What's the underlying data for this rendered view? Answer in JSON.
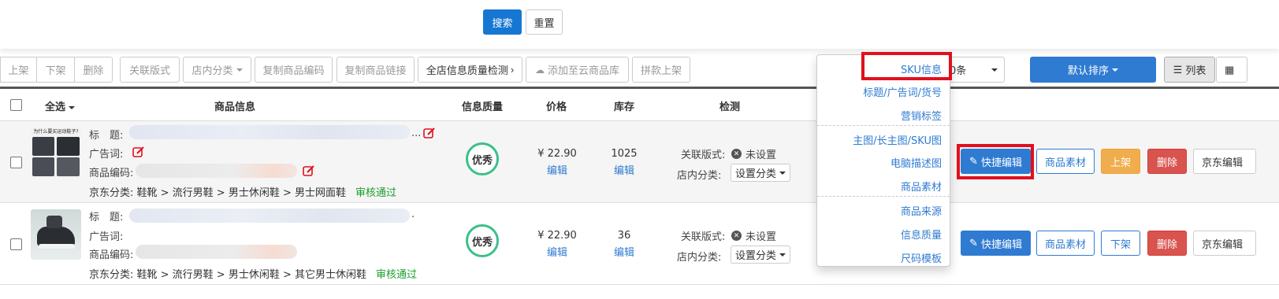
{
  "filters": {
    "search_label": "搜索",
    "reset_label": "重置"
  },
  "toolbar": {
    "buttons": [
      "上架",
      "下架",
      "删除",
      "关联版式",
      "店内分类",
      "复制商品编码",
      "复制商品链接",
      "全店信息质量检测",
      "添加至云商品库",
      "拼款上架"
    ],
    "page_size_value": "0条",
    "sort_label": "默认排序",
    "view_list_label": "列表"
  },
  "table": {
    "headers": {
      "select_all": "全选",
      "product_info": "商品信息",
      "quality": "信息质量",
      "price": "价格",
      "stock": "库存",
      "check": "检测"
    },
    "field_labels": {
      "title": "标　题:",
      "ad": "广告词:",
      "code": "商品编码:",
      "linked_layout": "关联版式:",
      "store_category": "店内分类:"
    },
    "rows": [
      {
        "title_suffix": "...",
        "jd_category": "京东分类: 鞋靴 > 流行男鞋 > 男士休闲鞋 > 男士网面鞋",
        "review_status": "审核通过",
        "quality": "优秀",
        "price": "¥ 22.90",
        "price_edit": "编辑",
        "stock": "1025",
        "stock_edit": "编辑",
        "linked_layout_value": "未设置",
        "store_category_value": "设置分类",
        "actions": [
          "快捷编辑",
          "商品素材",
          "上架",
          "删除",
          "京东编辑"
        ]
      },
      {
        "title_suffix": ".",
        "jd_category": "京东分类: 鞋靴 > 流行男鞋 > 男士休闲鞋 > 其它男士休闲鞋",
        "review_status": "审核通过",
        "quality": "优秀",
        "price": "¥ 22.90",
        "price_edit": "编辑",
        "stock": "36",
        "stock_edit": "编辑",
        "linked_layout_value": "未设置",
        "store_category_value": "设置分类",
        "actions": [
          "快捷编辑",
          "商品素材",
          "下架",
          "删除",
          "京东编辑"
        ]
      }
    ]
  },
  "dropdown": {
    "items": [
      "SKU信息",
      "标题/广告词/货号",
      "营销标签",
      "主图/长主图/SKU图",
      "电脑描述图",
      "商品素材",
      "商品来源",
      "信息质量",
      "尺码模板"
    ]
  },
  "thumb_caption": "为什么要买运动鞋子?",
  "colors": {
    "primary": "#2f7bd1",
    "highlight": "#e0101e",
    "quality_ring": "#3cc08a",
    "review_ok": "#1a9e2b"
  }
}
